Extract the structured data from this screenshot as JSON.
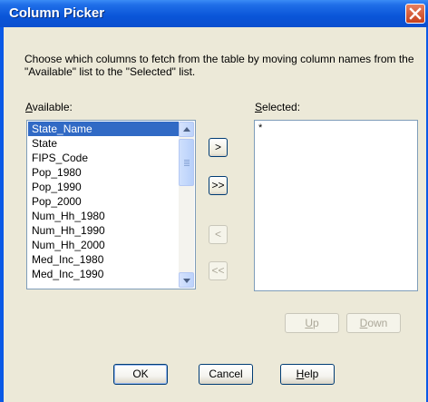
{
  "window": {
    "title": "Column Picker",
    "close_glyph": "✕"
  },
  "description": "Choose which columns to fetch from the table by moving column names from the \"Available\" list to the \"Selected\" list.",
  "available": {
    "label_accel": "A",
    "label_rest": "vailable:",
    "items": [
      "State_Name",
      "State",
      "FIPS_Code",
      "Pop_1980",
      "Pop_1990",
      "Pop_2000",
      "Num_Hh_1980",
      "Num_Hh_1990",
      "Num_Hh_2000",
      "Med_Inc_1980",
      "Med_Inc_1990"
    ],
    "selected_item": "State_Name"
  },
  "selected": {
    "label_accel": "S",
    "label_rest": "elected:",
    "placeholder": "*"
  },
  "move_buttons": {
    "add": ">",
    "add_all": ">>",
    "remove": "<",
    "remove_all": "<<"
  },
  "order_buttons": {
    "up_accel": "U",
    "up_rest": "p",
    "down_accel": "D",
    "down_rest": "own"
  },
  "dialog_buttons": {
    "ok": "OK",
    "cancel": "Cancel",
    "help_accel": "H",
    "help_rest": "elp"
  }
}
